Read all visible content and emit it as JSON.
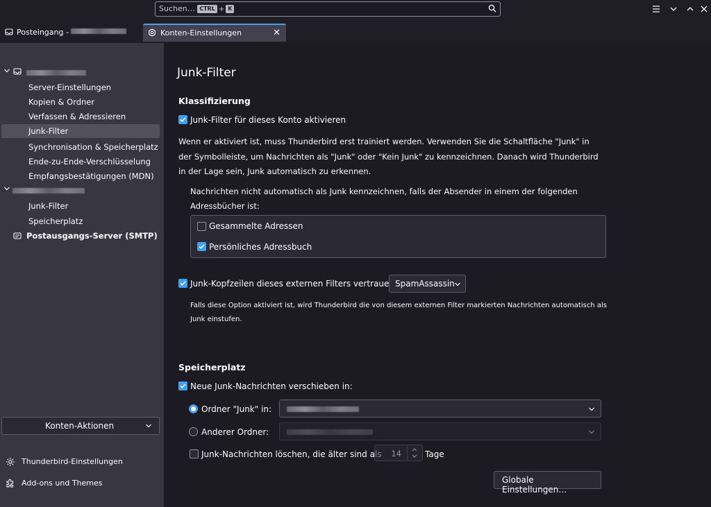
{
  "search": {
    "placeholder": "Suchen…",
    "shortcut_mod": "CTRL",
    "shortcut_key": "K"
  },
  "tabs": [
    {
      "label": "Posteingang -",
      "icon": "inbox-icon"
    },
    {
      "label": "Konten-Einstellungen",
      "icon": "gear-icon"
    }
  ],
  "sidebar": {
    "account1_items": [
      "Server-Einstellungen",
      "Kopien & Ordner",
      "Verfassen & Adressieren",
      "Junk-Filter",
      "Synchronisation & Speicherplatz",
      "Ende-zu-Ende-Verschlüsselung",
      "Empfangsbestätigungen (MDN)"
    ],
    "account2_items": [
      "Junk-Filter",
      "Speicherplatz"
    ],
    "smtp": "Postausgangs-Server (SMTP)",
    "actions_button": "Konten-Aktionen",
    "footer": [
      "Thunderbird-Einstellungen",
      "Add-ons und Themes"
    ]
  },
  "main": {
    "title": "Junk-Filter",
    "section1": "Klassifizierung",
    "enable_label": "Junk-Filter für dieses Konto aktivieren",
    "enable_checked": true,
    "explain": "Wenn er aktiviert ist, muss Thunderbird erst trainiert werden. Verwenden Sie die Schaltfläche \"Junk\" in der Symbolleiste, um Nachrichten als \"Junk\" oder \"Kein Junk\" zu kennzeichnen. Danach wird Thunderbird in der Lage sein, Junk automatisch zu erkennen.",
    "whitelist_text": "Nachrichten nicht automatisch als Junk kennzeichnen, falls der Absender in einem der folgenden Adressbücher ist:",
    "addressbooks": [
      {
        "label": "Gesammelte Adressen",
        "checked": false
      },
      {
        "label": "Persönliches Adressbuch",
        "checked": true
      }
    ],
    "trust_label": "Junk-Kopfzeilen dieses externen Filters vertrauen:",
    "trust_checked": true,
    "trust_select": "SpamAssassin",
    "trust_note": "Falls diese Option aktiviert ist, wird Thunderbird die von diesem externen Filter markierten Nachrichten automatisch als Junk einstufen.",
    "section2": "Speicherplatz",
    "move_label": "Neue Junk-Nachrichten verschieben in:",
    "move_checked": true,
    "radio1_label": "Ordner \"Junk\" in:",
    "radio2_label": "Anderer Ordner:",
    "delete_label": "Junk-Nachrichten löschen, die älter sind als",
    "delete_checked": false,
    "delete_days": "14",
    "delete_unit": "Tage",
    "global_button": "Globale Einstellungen…"
  },
  "colors": {
    "accent": "#3d9ff5",
    "sidebar_bg": "#38373f",
    "content_bg": "#1c1b22"
  }
}
